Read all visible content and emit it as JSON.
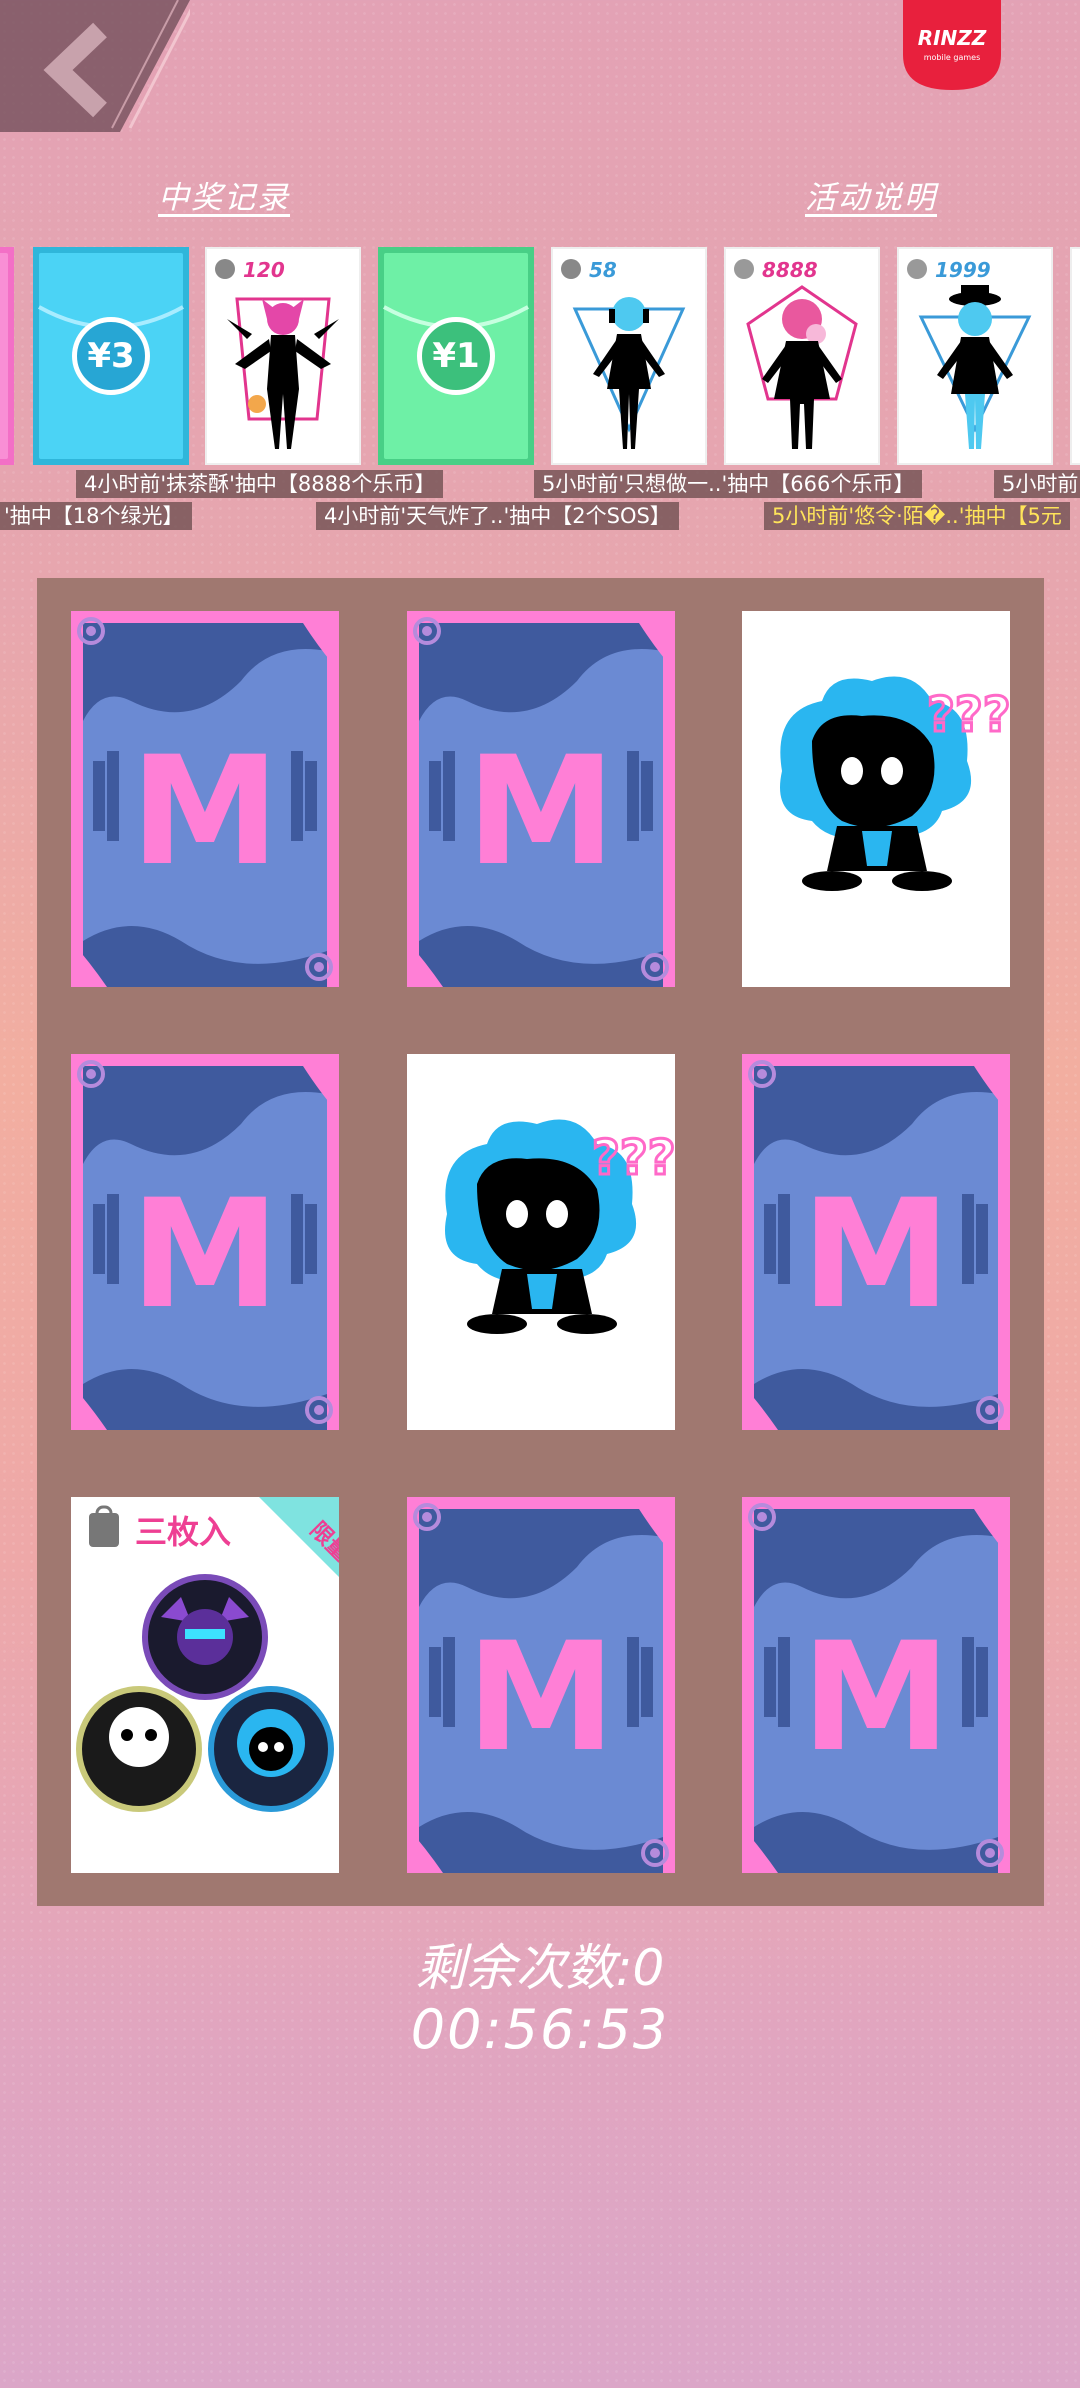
{
  "header": {
    "back_icon": "chevron-left-icon",
    "logo_text": "RINZZ",
    "logo_subtext": "mobile games",
    "links": {
      "history": "中奖记录",
      "rules": "活动说明"
    }
  },
  "prize_strip": [
    {
      "kind": "envelope",
      "color": "#f36fc6",
      "label": ""
    },
    {
      "kind": "envelope",
      "color": "#4bd3f5",
      "label": "¥3"
    },
    {
      "kind": "character",
      "cost": "120",
      "cost_color": "#e2358e",
      "icon": "bat-girl-silhouette-icon"
    },
    {
      "kind": "envelope",
      "color": "#6ef0a6",
      "label": "¥1"
    },
    {
      "kind": "character",
      "cost": "58",
      "cost_color": "#3a9ad8",
      "icon": "headphone-girl-silhouette-icon"
    },
    {
      "kind": "character",
      "cost": "8888",
      "cost_color": "#e2358e",
      "icon": "bubblegum-girl-silhouette-icon"
    },
    {
      "kind": "character",
      "cost": "1999",
      "cost_color": "#3a9ad8",
      "icon": "hat-girl-silhouette-icon"
    }
  ],
  "tickers": {
    "row1": [
      "4小时前'抹茶酥'抽中【8888个乐币】",
      "5小时前'只想做一..'抽中【666个乐币】",
      "5小时前"
    ],
    "row2": [
      "'抽中【18个绿光】",
      "4小时前'天气炸了..'抽中【2个SOS】",
      "5小时前'悠令·陌�..'抽中【5元"
    ]
  },
  "grid": [
    {
      "state": "back",
      "letter": "M"
    },
    {
      "state": "back",
      "letter": "M"
    },
    {
      "state": "revealed",
      "item": "blue-hair-character-icon"
    },
    {
      "state": "back",
      "letter": "M"
    },
    {
      "state": "revealed",
      "item": "blue-hair-character-icon"
    },
    {
      "state": "back",
      "letter": "M"
    },
    {
      "state": "badge_set",
      "title": "三枚入",
      "ribbon": "限量"
    },
    {
      "state": "back",
      "letter": "M"
    },
    {
      "state": "back",
      "letter": "M"
    }
  ],
  "colors": {
    "card_frame": "#ff7fd6",
    "card_body": "#6b8ad3",
    "card_dark": "#3f5a9e",
    "m_letter": "#ff7fd6",
    "board": "#a07870"
  },
  "status": {
    "remaining": "剩余次数:0",
    "timer": "00:56:53"
  }
}
